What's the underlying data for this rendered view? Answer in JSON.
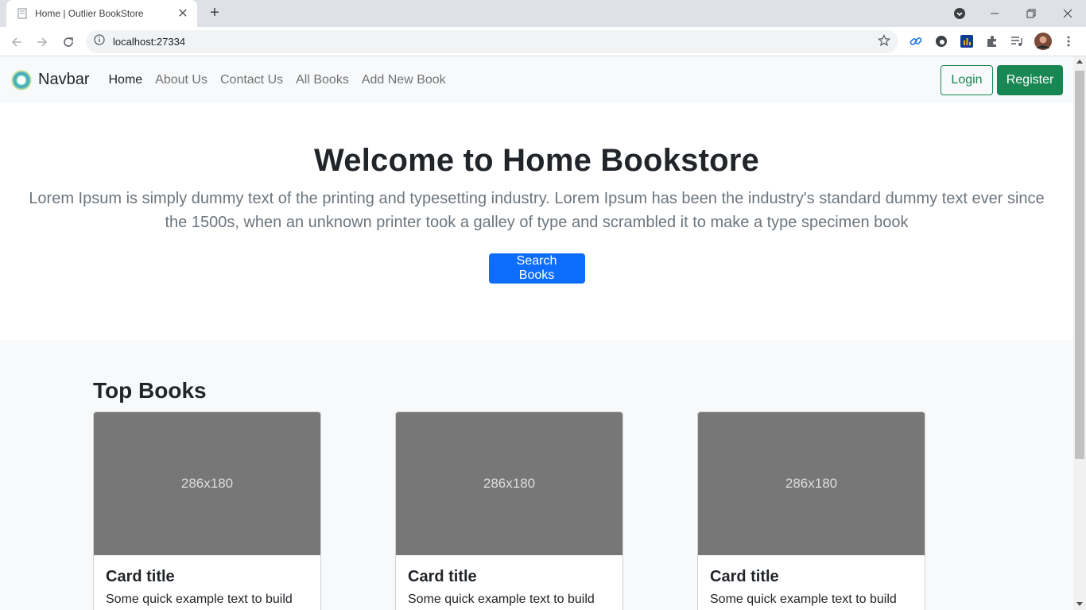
{
  "browser": {
    "tab_title": "Home | Outlier BookStore",
    "url": "localhost:27334"
  },
  "navbar": {
    "brand": "Navbar",
    "links": [
      "Home",
      "About Us",
      "Contact Us",
      "All Books",
      "Add New Book"
    ],
    "login": "Login",
    "register": "Register"
  },
  "hero": {
    "title": "Welcome to Home Bookstore",
    "text": "Lorem Ipsum is simply dummy text of the printing and typesetting industry. Lorem Ipsum has been the industry's standard dummy text ever since the 1500s, when an unknown printer took a galley of type and scrambled it to make a type specimen book",
    "button": "Search Books"
  },
  "top_books": {
    "heading": "Top Books",
    "cards": [
      {
        "image": "286x180",
        "title": "Card title",
        "text": "Some quick example text to build"
      },
      {
        "image": "286x180",
        "title": "Card title",
        "text": "Some quick example text to build"
      },
      {
        "image": "286x180",
        "title": "Card title",
        "text": "Some quick example text to build"
      }
    ]
  },
  "colors": {
    "primary": "#0d6efd",
    "success": "#198754",
    "navbar_bg": "#f8f9fa",
    "placeholder_bg": "#777777"
  }
}
